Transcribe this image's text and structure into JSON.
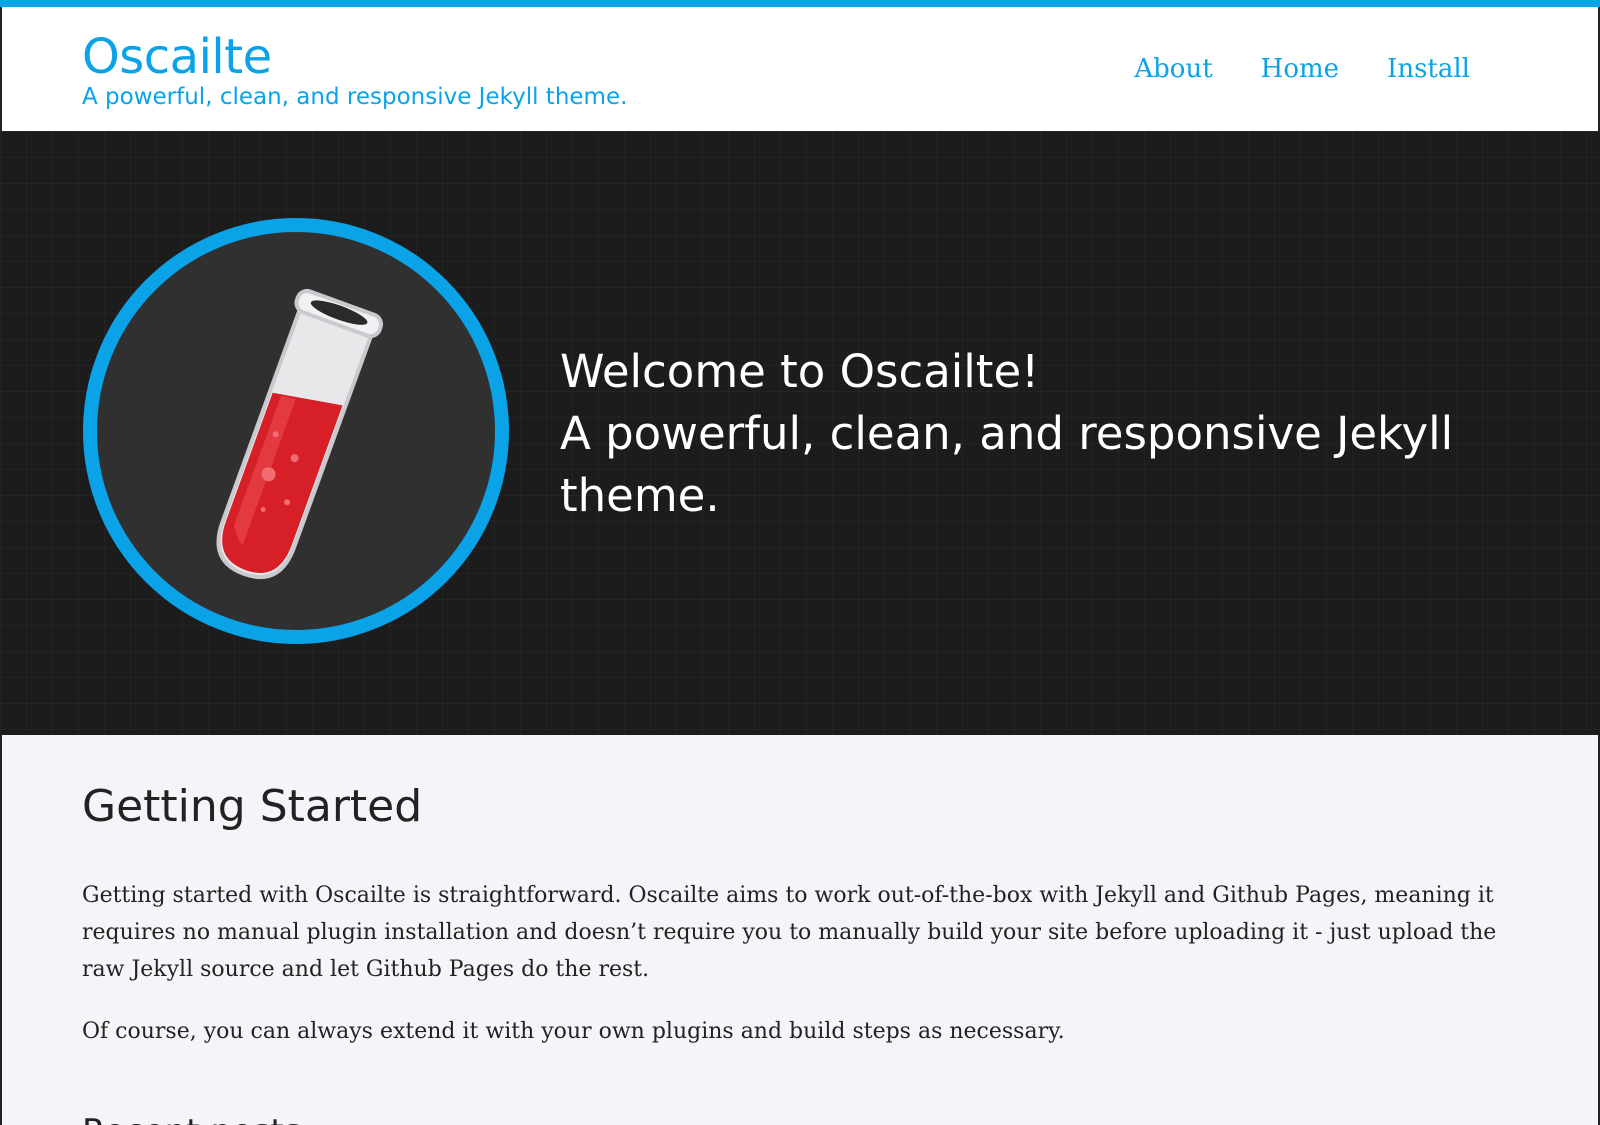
{
  "colors": {
    "accent": "#0aa3e8",
    "hero_bg": "#1c1c1d",
    "content_bg": "#f4f5f8",
    "text": "#222222",
    "liquid": "#d71f28"
  },
  "header": {
    "title": "Oscailte",
    "subtitle": "A powerful, clean, and responsive Jekyll theme.",
    "nav": [
      {
        "label": "About"
      },
      {
        "label": "Home"
      },
      {
        "label": "Install"
      }
    ]
  },
  "hero": {
    "logo_icon": "test-tube-icon",
    "line1": "Welcome to Oscailte!",
    "line2": "A powerful, clean, and responsive Jekyll",
    "line3": "theme."
  },
  "main": {
    "heading": "Getting Started",
    "paragraph1": "Getting started with Oscailte is straightforward. Oscailte aims to work out-of-the-box with Jekyll and Github Pages, meaning it requires no manual plugin installation and doesn’t require you to manually build your site before uploading it - just upload the raw Jekyll source and let Github Pages do the rest.",
    "paragraph2": "Of course, you can always extend it with your own plugins and build steps as necessary.",
    "recent_posts_heading": "Recent posts"
  }
}
